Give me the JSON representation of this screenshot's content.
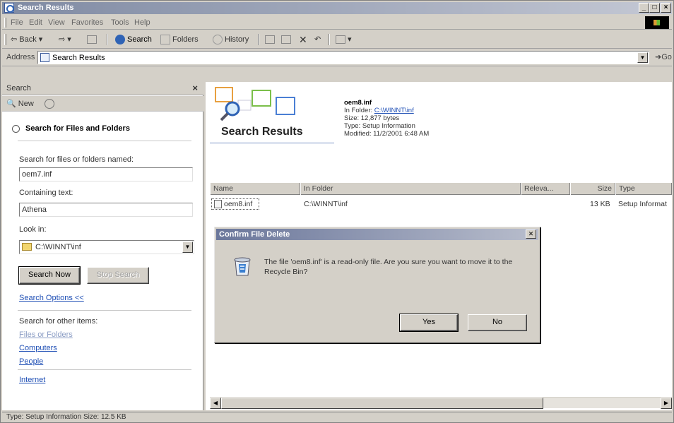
{
  "window": {
    "title": "Search Results",
    "controls": {
      "minimize": "_",
      "maximize": "□",
      "close": "×"
    }
  },
  "menubar": {
    "items": [
      "File",
      "Edit",
      "View",
      "Favorites",
      "Tools",
      "Help"
    ]
  },
  "toolbar": {
    "back": "Back",
    "search": "Search",
    "folders": "Folders",
    "history": "History"
  },
  "addressbar": {
    "label": "Address",
    "value": "Search Results",
    "go": "Go"
  },
  "search_pane": {
    "header": "Search",
    "new_label": "New",
    "section_title": "Search for Files and Folders",
    "named_label": "Search for files or folders named:",
    "named_value": "oem7.inf",
    "containing_label": "Containing text:",
    "containing_value": "Athena",
    "lookin_label": "Look in:",
    "lookin_value": "C:\\WINNT\\inf",
    "search_now": "Search Now",
    "stop_search": "Stop Search",
    "search_options": "Search Options <<",
    "other_items_label": "Search for other items:",
    "other_links": [
      "Files or Folders",
      "Computers",
      "People",
      "Internet"
    ]
  },
  "results": {
    "banner_title": "Search Results",
    "file": {
      "name": "oem8.inf",
      "folder_label": "In Folder:",
      "folder_link": "C:\\WINNT\\inf",
      "size": "Size: 12,877 bytes",
      "type": "Type: Setup Information",
      "modified": "Modified: 11/2/2001 6:48 AM"
    },
    "columns": [
      "Name",
      "In Folder",
      "Releva...",
      "Size",
      "Type"
    ],
    "rows": [
      {
        "name": "oem8.inf",
        "folder": "C:\\WINNT\\inf",
        "relevance": "",
        "size": "13 KB",
        "type": "Setup Informat"
      }
    ]
  },
  "dialog": {
    "title": "Confirm File Delete",
    "message": "The file 'oem8.inf' is a read-only file. Are you sure you want to move it to the Recycle Bin?",
    "yes": "Yes",
    "no": "No"
  },
  "statusbar": {
    "text": "Type: Setup Information Size: 12.5 KB"
  }
}
